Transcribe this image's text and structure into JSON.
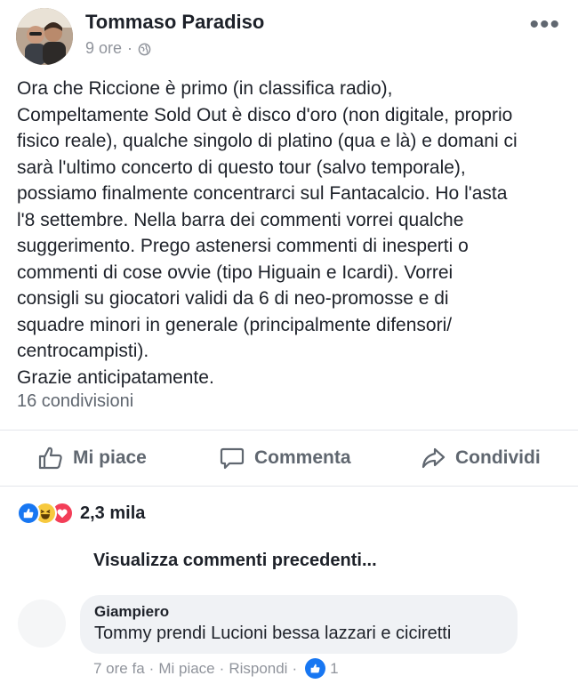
{
  "post": {
    "author": "Tommaso Paradiso",
    "time": "9 ore",
    "separator": "·",
    "text": "Ora che Riccione è primo (in classifica radio),\nCompeltamente Sold Out è disco d'oro (non digitale, proprio\nfisico reale), qualche singolo di platino (qua e là) e domani ci\nsarà l'ultimo concerto di questo tour (salvo temporale),\npossiamo finalmente concentrarci sul Fantacalcio. Ho l'asta\nl'8 settembre. Nella barra dei commenti vorrei qualche\nsuggerimento. Prego astenersi commenti di inesperti o\ncommenti di cose ovvie (tipo Higuain e Icardi). Vorrei\nconsigli su giocatori validi da 6 di neo-promosse e di\nsquadre minori in generale (principalmente difensori/\ncentrocampisti).\nGrazie anticipatamente.",
    "shares": "16 condivisioni",
    "more_icon": "more-horizontal-icon",
    "privacy_icon": "globe-icon"
  },
  "actions": {
    "like": "Mi piace",
    "comment": "Commenta",
    "share": "Condividi"
  },
  "reactions": {
    "types": [
      "like",
      "haha",
      "love"
    ],
    "count": "2,3 mila"
  },
  "comments": {
    "view_previous": "Visualizza commenti precedenti...",
    "items": [
      {
        "name": "Giampiero",
        "text": "Tommy prendi Lucioni bessa lazzari e ciciretti",
        "time": "7 ore fa",
        "sep": "·",
        "like_label": "Mi piace",
        "reply_label": "Rispondi",
        "like_count": "1"
      }
    ]
  },
  "colors": {
    "brand_blue": "#1877f2",
    "text": "#1d2129",
    "secondary": "#606770",
    "bubble": "#f0f2f5"
  }
}
